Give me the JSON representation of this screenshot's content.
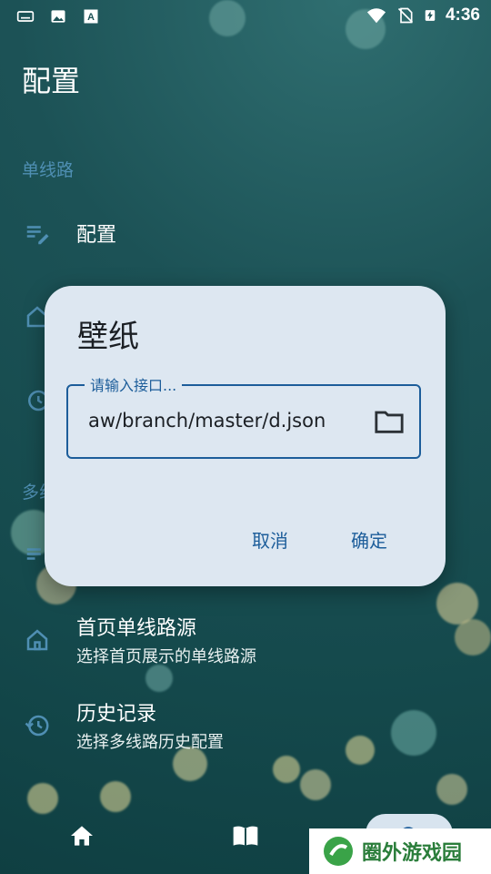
{
  "status_bar": {
    "time": "4:36"
  },
  "page": {
    "title": "配置"
  },
  "sections": [
    {
      "label": "单线路"
    },
    {
      "label": "多线路"
    }
  ],
  "rows": [
    {
      "icon": "edit-list-icon",
      "title": "配置"
    },
    {
      "icon": "home-icon",
      "title": "首页单线路源",
      "subtitle": "选择首页展示的单线路源"
    },
    {
      "icon": "history-icon",
      "title": "历史记录",
      "subtitle": "选择多线路历史配置"
    }
  ],
  "dialog": {
    "title": "壁纸",
    "field_label": "请输入接口...",
    "field_value": "aw/branch/master/d.json",
    "cancel_label": "取消",
    "confirm_label": "确定"
  },
  "watermark": {
    "text": "圈外游戏园"
  },
  "colors": {
    "accent": "#1c5d9a",
    "dialog_bg": "#dde7f1",
    "section_label": "#4f8fb3"
  }
}
